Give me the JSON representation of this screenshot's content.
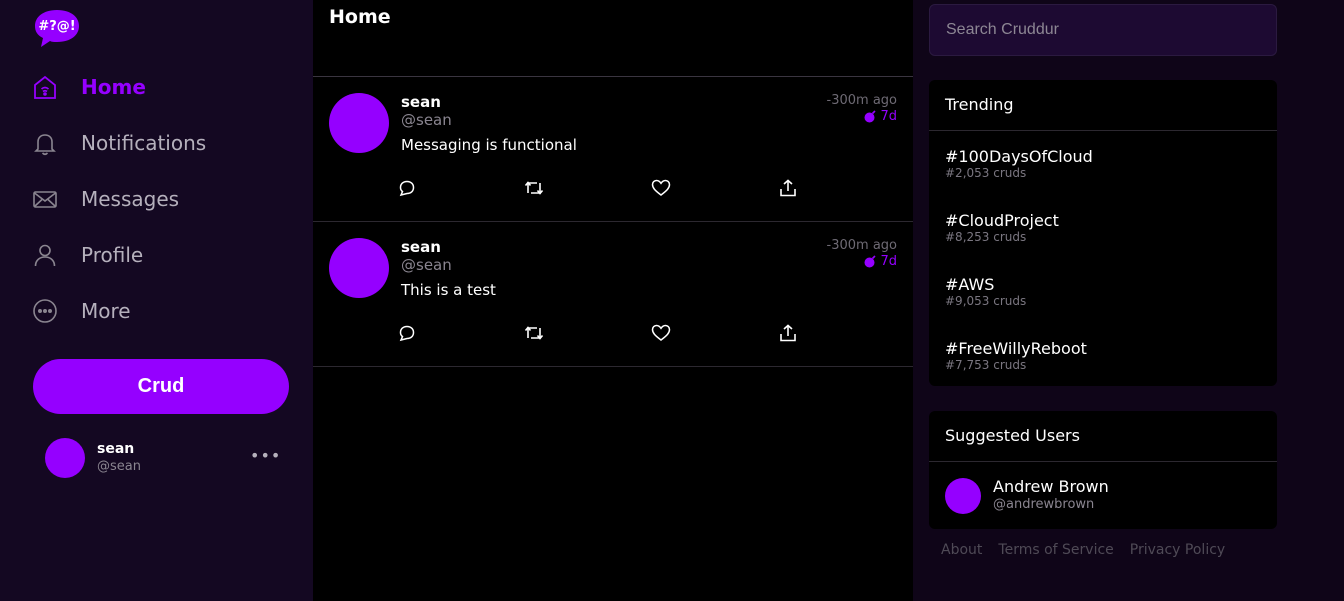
{
  "sidebar": {
    "logo_text": "#?@!",
    "nav": [
      {
        "label": "Home",
        "icon": "home-icon",
        "active": true
      },
      {
        "label": "Notifications",
        "icon": "bell-icon",
        "active": false
      },
      {
        "label": "Messages",
        "icon": "envelope-icon",
        "active": false
      },
      {
        "label": "Profile",
        "icon": "user-icon",
        "active": false
      },
      {
        "label": "More",
        "icon": "more-circle-icon",
        "active": false
      }
    ],
    "crud_button": "Crud",
    "user": {
      "name": "sean",
      "handle": "@sean",
      "more": "•••"
    }
  },
  "feed": {
    "title": "Home",
    "cruds": [
      {
        "name": "sean",
        "handle": "@sean",
        "message": "Messaging is functional",
        "time": "-300m ago",
        "expires": "7d"
      },
      {
        "name": "sean",
        "handle": "@sean",
        "message": "This is a test",
        "time": "-300m ago",
        "expires": "7d"
      }
    ]
  },
  "search": {
    "placeholder": "Search Cruddur"
  },
  "trending": {
    "title": "Trending",
    "items": [
      {
        "tag": "#100DaysOfCloud",
        "count": "#2,053 cruds"
      },
      {
        "tag": "#CloudProject",
        "count": "#8,253 cruds"
      },
      {
        "tag": "#AWS",
        "count": "#9,053 cruds"
      },
      {
        "tag": "#FreeWillyReboot",
        "count": "#7,753 cruds"
      }
    ]
  },
  "suggested": {
    "title": "Suggested Users",
    "users": [
      {
        "name": "Andrew Brown",
        "handle": "@andrewbrown"
      }
    ]
  },
  "footer": {
    "about": "About",
    "terms": "Terms of Service",
    "privacy": "Privacy Policy"
  },
  "colors": {
    "accent": "#9500ff",
    "sidebar_bg": "#140822",
    "page_bg": "#0f0518",
    "feed_bg": "#000000"
  }
}
